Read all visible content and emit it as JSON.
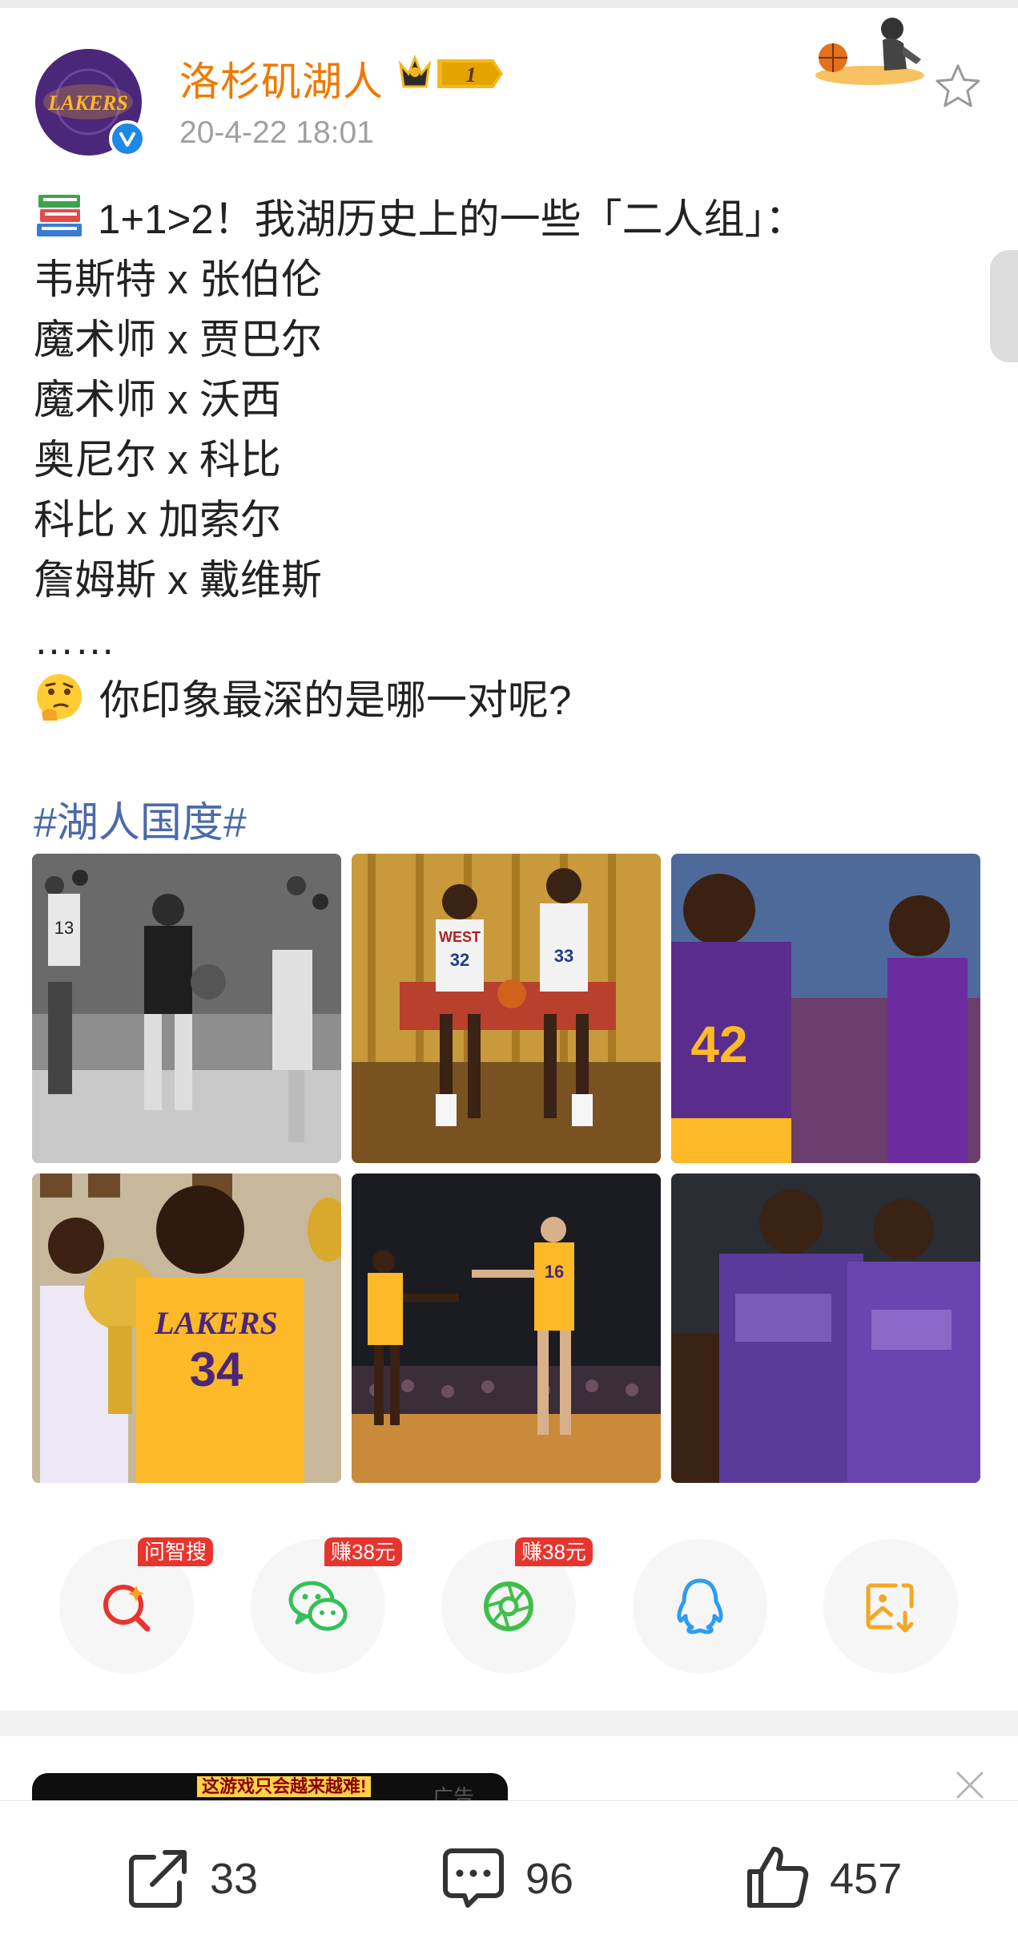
{
  "post": {
    "author": "洛杉矶湖人",
    "badge_level": "1",
    "timestamp": "20-4-22 18:01",
    "text_lines": [
      "1+1>2！我湖历史上的一些「二人组」：",
      "韦斯特 x 张伯伦",
      "魔术师 x 贾巴尔",
      "魔术师 x 沃西",
      "奥尼尔 x 科比",
      "科比 x 加索尔",
      "詹姆斯 x 戴维斯",
      "……",
      "你印象最深的是哪一对呢?"
    ],
    "hashtag": "#湖人国度#",
    "avatar_logo_text": "LAKERS",
    "icons": {
      "verified": "verified-v-icon",
      "favorite": "star-outline-icon",
      "book_emoji": "books-emoji-icon",
      "thinking_emoji": "thinking-face-emoji-icon"
    }
  },
  "photos": [
    {
      "name": "photo-west-chamberlain",
      "jersey": "13"
    },
    {
      "name": "photo-magic-jabbar",
      "jersey_left": "32",
      "jersey_right": "33",
      "text": "WEST"
    },
    {
      "name": "photo-magic-worthy",
      "jersey": "42"
    },
    {
      "name": "photo-shaq-kobe",
      "jersey": "34",
      "text": "LAKERS"
    },
    {
      "name": "photo-kobe-gasol",
      "jersey": "16"
    },
    {
      "name": "photo-ad-lebron"
    }
  ],
  "share": {
    "items": [
      {
        "name": "share-wenzhisou",
        "tag": "问智搜",
        "icon": "ai-search-icon",
        "color": "#e7352e"
      },
      {
        "name": "share-wechat",
        "tag": "赚38元",
        "icon": "wechat-icon",
        "color": "#33c05a"
      },
      {
        "name": "share-moments",
        "tag": "赚38元",
        "icon": "moments-aperture-icon",
        "color": "#3fbf4a"
      },
      {
        "name": "share-qq",
        "tag": "",
        "icon": "qq-penguin-icon",
        "color": "#2d9cf0"
      },
      {
        "name": "share-save-image",
        "tag": "",
        "icon": "save-image-icon",
        "color": "#f5a623"
      }
    ]
  },
  "ad": {
    "caption": "这游戏只会越来越难!",
    "label": "广告",
    "close_icon": "close-x-icon"
  },
  "actions": {
    "repost": {
      "count": "33",
      "icon": "repost-icon"
    },
    "comment": {
      "count": "96",
      "icon": "comment-bubble-icon"
    },
    "like": {
      "count": "457",
      "icon": "thumbs-up-icon"
    }
  },
  "colors": {
    "author": "#f07800",
    "hashtag": "#4b6aa8",
    "timestamp": "#a0a0a0",
    "tag_red": "#e7352e",
    "lakers_purple": "#4a2779",
    "lakers_gold": "#fdb927"
  }
}
